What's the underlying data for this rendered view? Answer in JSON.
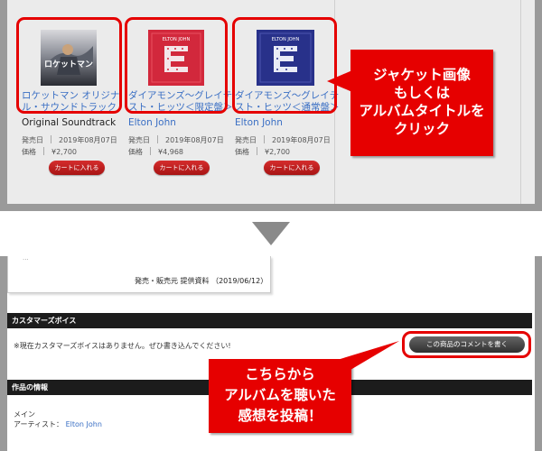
{
  "colors": {
    "highlight": "#e60000",
    "link": "#3a6fc4",
    "cart_button": "#c01d1d",
    "section_bar": "#1c1c1c"
  },
  "top": {
    "products": [
      {
        "jacket_text": "ロケットマン",
        "title": "ロケットマン オリジナル・サウンドトラック",
        "artist": "Original Soundtrack",
        "release_label": "発売日",
        "release_date": "2019年08月07日",
        "price_label": "価格",
        "price": "¥2,700",
        "cart_label": "カートに入れる"
      },
      {
        "jacket_text": "ELTON JOHN",
        "title": "ダイアモンズ〜グレイテスト・ヒッツ＜限定盤＞",
        "artist": "Elton John",
        "release_label": "発売日",
        "release_date": "2019年08月07日",
        "price_label": "価格",
        "price": "¥4,968",
        "cart_label": "カートに入れる"
      },
      {
        "jacket_text": "ELTON JOHN",
        "title": "ダイアモンズ〜グレイテスト・ヒッツ＜通常盤＞",
        "artist": "Elton John",
        "release_label": "発売日",
        "release_date": "2019年08月07日",
        "price_label": "価格",
        "price": "¥2,700",
        "cart_label": "カートに入れる"
      }
    ],
    "callout_lines": [
      "ジャケット画像",
      "もしくは",
      "アルバムタイトルを",
      "クリック"
    ]
  },
  "bottom": {
    "provider": "発売・販売元 提供資料 （2019/06/12）",
    "customer_voice_header": "カスタマーズボイス",
    "notice": "※現在カスタマーズボイスはありません。ぜひ書き込んでください!",
    "comment_button": "この商品のコメントを書く",
    "work_info_header": "作品の情報",
    "main_label": "メイン",
    "artist_label": "アーティスト：",
    "artist_value": "Elton John",
    "callout_lines": [
      "こちらから",
      "アルバムを聴いた",
      "感想を投稿！"
    ]
  }
}
